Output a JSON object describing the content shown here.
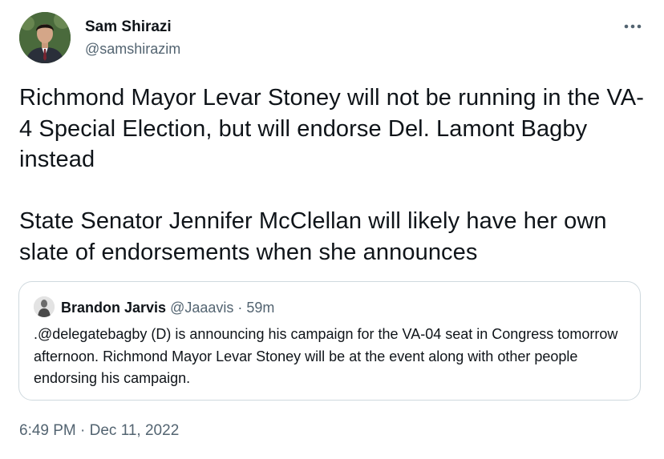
{
  "tweet": {
    "author": {
      "name": "Sam Shirazi",
      "handle": "@samshirazim"
    },
    "more_icon": "more-horizontal-icon",
    "paragraphs": [
      "Richmond Mayor Levar Stoney will not be running in the VA-4 Special Election, but will endorse Del. Lamont Bagby instead",
      "State Senator Jennifer McClellan will likely have her own slate of endorsements when she announces"
    ],
    "timestamp": "6:49 PM · Dec 11, 2022"
  },
  "quoted_tweet": {
    "name": "Brandon Jarvis",
    "handle": "@Jaaavis",
    "separator": " · ",
    "time": "59m",
    "text": ".@delegatebagby (D) is announcing his campaign for the VA-04 seat in Congress tomorrow afternoon. Richmond Mayor Levar Stoney will be at the event along with other people endorsing his campaign."
  },
  "colors": {
    "text": "#0f1419",
    "secondary": "#536471",
    "border": "#cfd9de"
  }
}
